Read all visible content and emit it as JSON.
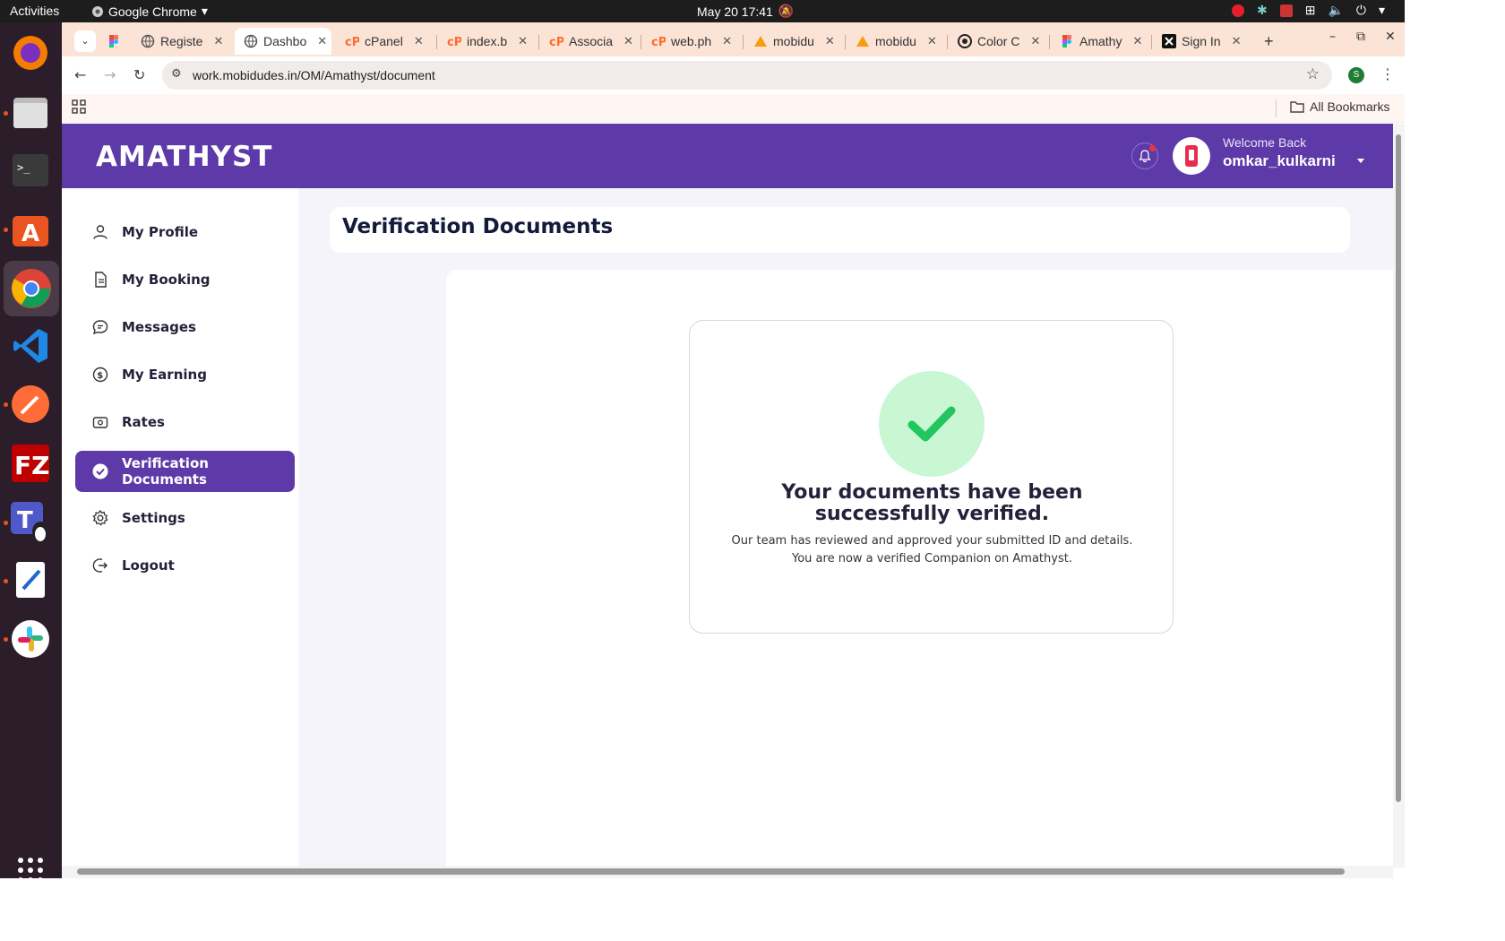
{
  "topbar": {
    "activities": "Activities",
    "app_name": "Google Chrome",
    "clock": "May 20  17:41"
  },
  "tabs": [
    {
      "label": "Registe",
      "icon": "figma-icon"
    },
    {
      "label": "Dashbo",
      "icon": "globe-icon",
      "active": true
    },
    {
      "label": "cPanel",
      "icon": "cpanel-icon"
    },
    {
      "label": "index.b",
      "icon": "cpanel-icon"
    },
    {
      "label": "Associa",
      "icon": "cpanel-icon"
    },
    {
      "label": "web.ph",
      "icon": "cpanel-icon"
    },
    {
      "label": "mobidu",
      "icon": "pma-icon"
    },
    {
      "label": "mobidu",
      "icon": "pma-icon"
    },
    {
      "label": "Color C",
      "icon": "color-icon"
    },
    {
      "label": "Amathy",
      "icon": "figma-icon"
    },
    {
      "label": "Sign In",
      "icon": "x-icon"
    }
  ],
  "address": {
    "url": "work.mobidudes.in/OM/Amathyst/document",
    "profile_initial": "S"
  },
  "bookmarks": {
    "all_label": "All Bookmarks"
  },
  "header": {
    "logo": "AMATHYST",
    "welcome": "Welcome Back",
    "username": "omkar_kulkarni"
  },
  "sidebar": {
    "items": [
      {
        "label": "My Profile",
        "icon": "user-icon"
      },
      {
        "label": "My Booking",
        "icon": "document-icon"
      },
      {
        "label": "Messages",
        "icon": "chat-icon"
      },
      {
        "label": "My Earning",
        "icon": "dollar-icon"
      },
      {
        "label": "Rates",
        "icon": "money-icon"
      },
      {
        "label": "Verification Documents",
        "icon": "check-circle-icon",
        "active": true
      },
      {
        "label": "Settings",
        "icon": "gear-icon"
      },
      {
        "label": "Logout",
        "icon": "logout-icon"
      }
    ]
  },
  "main": {
    "title": "Verification Documents",
    "status_title": "Your documents have been successfully verified.",
    "status_desc": "Our team has reviewed and approved your submitted ID and details. You are now a verified Companion on Amathyst."
  },
  "colors": {
    "brand": "#5e3aa8",
    "success_bg": "#c9f7d4",
    "success": "#22c55e"
  }
}
